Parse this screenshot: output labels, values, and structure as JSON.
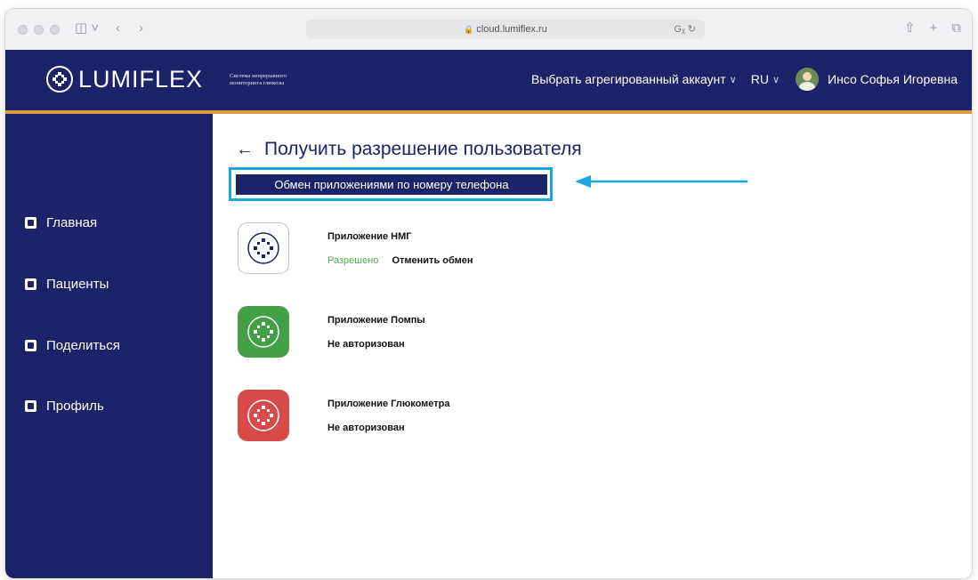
{
  "browser": {
    "url": "cloud.lumiflex.ru",
    "translate_icon": "Gᵪ ↻"
  },
  "header": {
    "logo_text": "LUMIFLEX",
    "logo_subtitle": "Система непрерывного мониторинга глюкозы",
    "account_selector": "Выбрать агрегированный аккаунт",
    "language": "RU",
    "user_name": "Инсо Софья Игоревна"
  },
  "sidebar": {
    "items": [
      {
        "label": "Главная",
        "icon": "home-icon"
      },
      {
        "label": "Пациенты",
        "icon": "patients-icon"
      },
      {
        "label": "Поделиться",
        "icon": "share-icon"
      },
      {
        "label": "Профиль",
        "icon": "profile-icon"
      }
    ]
  },
  "main": {
    "back_arrow": "←",
    "title": "Получить разрешение пользователя",
    "share_button": "Обмен приложениями по номеру телефона",
    "apps": [
      {
        "name": "Приложение НМГ",
        "status": "Разрешено",
        "action": "Отменить обмен",
        "color": "#ffffff"
      },
      {
        "name": "Приложение Помпы",
        "status": "Не авторизован",
        "color": "#43a047"
      },
      {
        "name": "Приложение Глюкометра",
        "status": "Не авторизован",
        "color": "#d84a4a"
      }
    ]
  },
  "colors": {
    "brand_navy": "#1c2469",
    "accent_orange": "#d99a3e",
    "highlight_blue": "#1aa7e0",
    "ok_green": "#4caf50"
  }
}
